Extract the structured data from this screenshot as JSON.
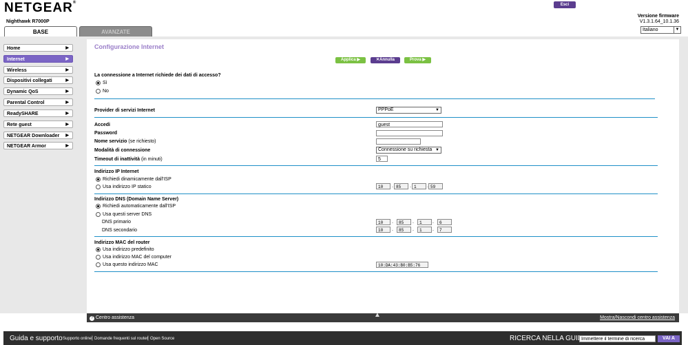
{
  "header": {
    "logo": "NETGEAR",
    "model": "Nighthawk R7000P",
    "tabs": [
      "BASE",
      "AVANZATE"
    ],
    "logout": "Esci",
    "firmware_label": "Versione firmware",
    "firmware_value": "V1.3.1.64_10.1.36",
    "language": "Italiano"
  },
  "sidebar": {
    "items": [
      {
        "label": "Home"
      },
      {
        "label": "Internet",
        "active": true
      },
      {
        "label": "Wireless"
      },
      {
        "label": "Dispositivi collegati"
      },
      {
        "label": "Dynamic QoS"
      },
      {
        "label": "Parental Control"
      },
      {
        "label": "ReadySHARE"
      },
      {
        "label": "Rete guest"
      },
      {
        "label": "NETGEAR Downloader"
      },
      {
        "label": "NETGEAR Armor"
      }
    ]
  },
  "main": {
    "title": "Configurazione Internet",
    "buttons": {
      "apply": "Applica ▶",
      "cancel": "✕Annulla",
      "test": "Prova ▶"
    },
    "login_question": "La connessione a Internet richiede dei dati di accesso?",
    "login_yes": "Sì",
    "login_no": "No",
    "isp_label": "Provider di servizi Internet",
    "isp_value": "PPPoE",
    "accedi_label": "Accedi",
    "accedi_value": "guest",
    "password_label": "Password",
    "service_label": "Nome servizio",
    "service_hint": "(se richiesto)",
    "mode_label": "Modalità di connessione",
    "mode_value": "Connessione su richiesta",
    "timeout_label": "Timeout di inattività",
    "timeout_hint": "(in minuti)",
    "timeout_value": "5",
    "ip_section": "Indirizzo IP Internet",
    "ip_dynamic": "Richiedi dinamicamente dall'ISP",
    "ip_static": "Usa indirizzo IP statico",
    "ip_octets": [
      "10",
      "85",
      "1",
      "59"
    ],
    "dns_section": "Indirizzo DNS (Domain Name Server)",
    "dns_auto": "Richiedi automaticamente dall'ISP",
    "dns_manual": "Usa questi server DNS",
    "dns_primary_label": "DNS primario",
    "dns_primary": [
      "10",
      "85",
      "1",
      "6"
    ],
    "dns_secondary_label": "DNS secondario",
    "dns_secondary": [
      "10",
      "85",
      "1",
      "7"
    ],
    "mac_section": "Indirizzo MAC del router",
    "mac_default": "Usa indirizzo predefinito",
    "mac_computer": "Usa indirizzo MAC del computer",
    "mac_custom": "Usa questo indirizzo MAC",
    "mac_value": "10:DA:43:B0:B5:76"
  },
  "helpbar": {
    "center": "Centro assistenza",
    "toggle": "Mostra/Nascondi centro assistenza"
  },
  "footer": {
    "title": "Guida e supporto",
    "links": [
      "Supporto online",
      "Domande frequenti sul router",
      "Open Source"
    ],
    "search_label": "RICERCA NELLA GUIDA",
    "search_placeholder": "Immettere il termine di ricerca",
    "search_button": "VAI A"
  }
}
